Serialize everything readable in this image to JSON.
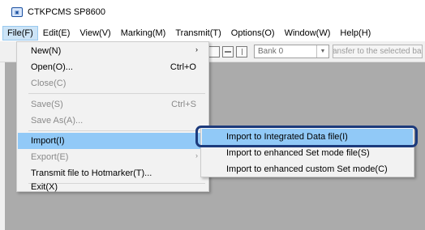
{
  "window": {
    "title": "CTKPCMS SP8600",
    "icon": "app-icon"
  },
  "menubar": {
    "items": [
      {
        "label": "File(F)"
      },
      {
        "label": "Edit(E)"
      },
      {
        "label": "View(V)"
      },
      {
        "label": "Marking(M)"
      },
      {
        "label": "Transmit(T)"
      },
      {
        "label": "Options(O)"
      },
      {
        "label": "Window(W)"
      },
      {
        "label": "Help(H)"
      }
    ],
    "active": "File(F)"
  },
  "toolbar": {
    "bank_select_value": "Bank  0",
    "transfer_label": "Transfer to the selected bank"
  },
  "file_menu": {
    "items": [
      {
        "label": "New(N)",
        "arrow": "›"
      },
      {
        "label": "Open(O)...",
        "shortcut": "Ctrl+O"
      },
      {
        "label": "Close(C)"
      },
      {
        "label": "Save(S)",
        "shortcut": "Ctrl+S"
      },
      {
        "label": "Save As(A)..."
      },
      {
        "label": "Import(I)"
      },
      {
        "label": "Export(E)",
        "arrow": "›"
      },
      {
        "label": "Transmit file to Hotmarker(T)..."
      },
      {
        "label": "Exit(X)"
      }
    ]
  },
  "import_submenu": {
    "items": [
      {
        "label": "Import to Integrated Data file(I)"
      },
      {
        "label": "Import to enhanced Set mode file(S)"
      },
      {
        "label": "Import to enhanced custom Set mode(C)"
      }
    ]
  },
  "colors": {
    "menu_highlight": "#91c9f7",
    "callout_border": "#1c3a7c",
    "workspace": "#ababab"
  }
}
